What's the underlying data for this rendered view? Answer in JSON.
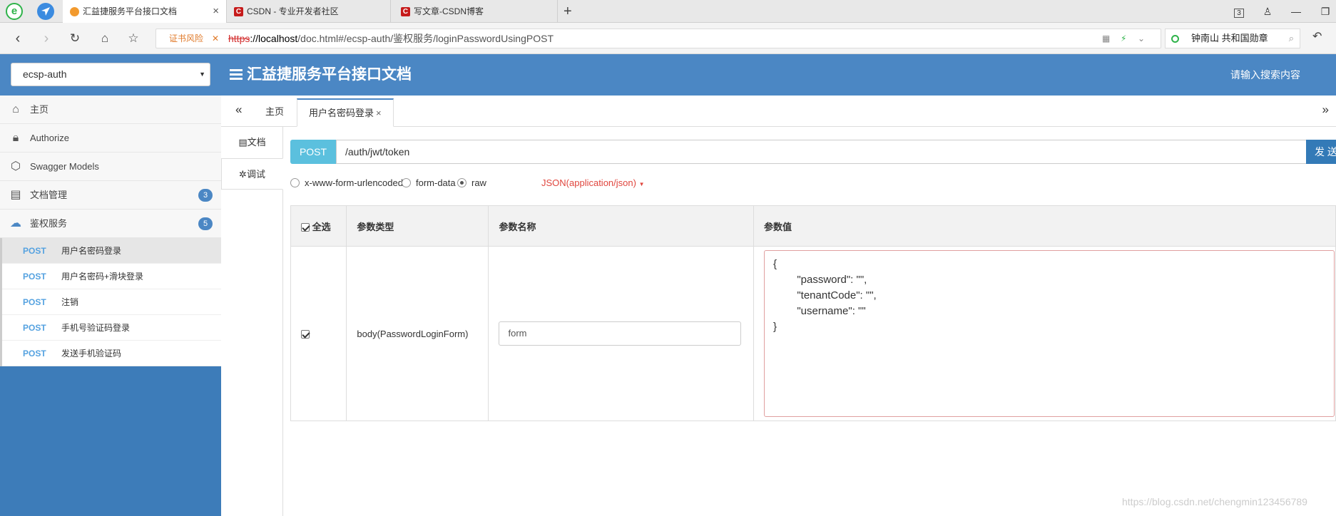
{
  "browser": {
    "tabs": [
      {
        "title": "汇益捷服务平台接口文档",
        "close": "×"
      },
      {
        "title": "CSDN - 专业开发者社区"
      },
      {
        "title": "写文章-CSDN博客"
      }
    ],
    "new_tab": "+",
    "tab_count": "3",
    "cert_warning": "证书风险",
    "url_proto": "https",
    "url_host": "://localhost",
    "url_path": "/doc.html#/ecsp-auth/鉴权服务/loginPasswordUsingPOST",
    "search_text": "钟南山 共和国勋章"
  },
  "header": {
    "project": "ecsp-auth",
    "title": "汇益捷服务平台接口文档",
    "search_placeholder": "请输入搜索内容"
  },
  "sidebar": {
    "items": [
      {
        "label": "主页",
        "icon": "home-icon"
      },
      {
        "label": "Authorize",
        "icon": "lock-icon"
      },
      {
        "label": "Swagger Models",
        "icon": "cube-icon"
      },
      {
        "label": "文档管理",
        "icon": "document-icon",
        "badge": "3"
      },
      {
        "label": "鉴权服务",
        "icon": "cloud-icon",
        "badge": "5"
      }
    ],
    "apis": [
      {
        "method": "POST",
        "label": "用户名密码登录"
      },
      {
        "method": "POST",
        "label": "用户名密码+滑块登录"
      },
      {
        "method": "POST",
        "label": "注销"
      },
      {
        "method": "POST",
        "label": "手机号验证码登录"
      },
      {
        "method": "POST",
        "label": "发送手机验证码"
      }
    ]
  },
  "content": {
    "tabs": [
      "主页",
      "用户名密码登录"
    ],
    "vtabs": [
      "文档",
      "调试"
    ],
    "method": "POST",
    "path": "/auth/jwt/token",
    "send": "发 送",
    "content_types": [
      "x-www-form-urlencoded",
      "form-data",
      "raw"
    ],
    "selected_content_type": "raw",
    "raw_type": "JSON(application/json)",
    "table": {
      "headers": [
        "全选",
        "参数类型",
        "参数名称",
        "参数值"
      ],
      "row": {
        "type": "body(PasswordLoginForm)",
        "name": "form",
        "value": "{\n        \"password\": \"\",\n        \"tenantCode\": \"\",\n        \"username\": \"\"\n}"
      }
    }
  },
  "watermark": "https://blog.csdn.net/chengmin123456789"
}
